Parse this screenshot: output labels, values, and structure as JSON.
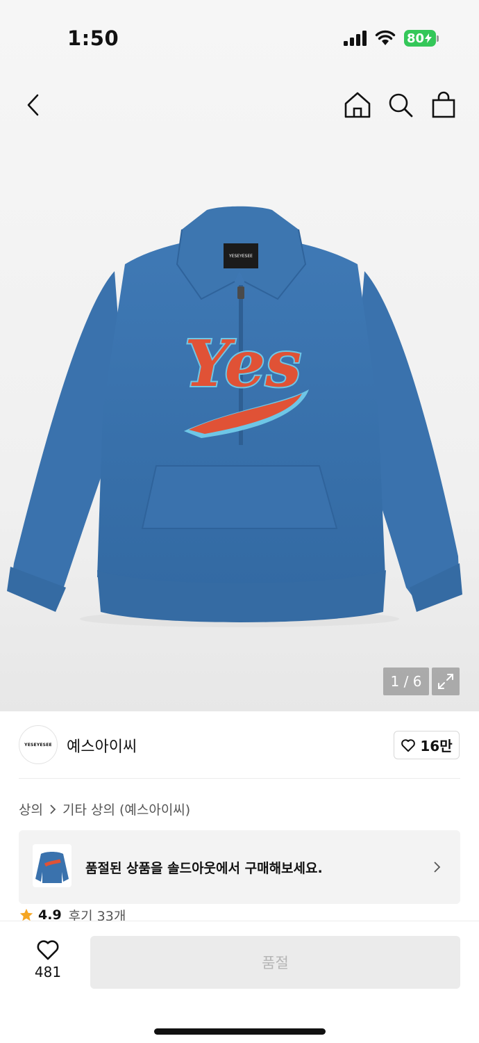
{
  "status_bar": {
    "time": "1:50",
    "battery": "80"
  },
  "header": {
    "icons": [
      "back-icon",
      "home-icon",
      "search-icon",
      "shopping-bag-icon"
    ]
  },
  "product_image": {
    "counter": "1 / 6",
    "label_text": "YESEYESEE",
    "graphic_text": "Yes",
    "colors": {
      "garment": "#3a72ad",
      "graphic": "#e05236",
      "outline": "#6ec6e6"
    }
  },
  "brand": {
    "logo_text": "YESEYESEE",
    "name": "예스아이씨",
    "likes": "16만"
  },
  "breadcrumb": {
    "items": [
      "상의",
      "기타 상의 (예스아이씨)"
    ]
  },
  "soldout_banner": {
    "text": "품절된 상품을 솔드아웃에서 구매해보세요."
  },
  "rating": {
    "score": "4.9",
    "reviews": "후기 33개",
    "star_color": "#f5a623"
  },
  "bottom_bar": {
    "wish_count": "481",
    "buy_label": "품절"
  }
}
